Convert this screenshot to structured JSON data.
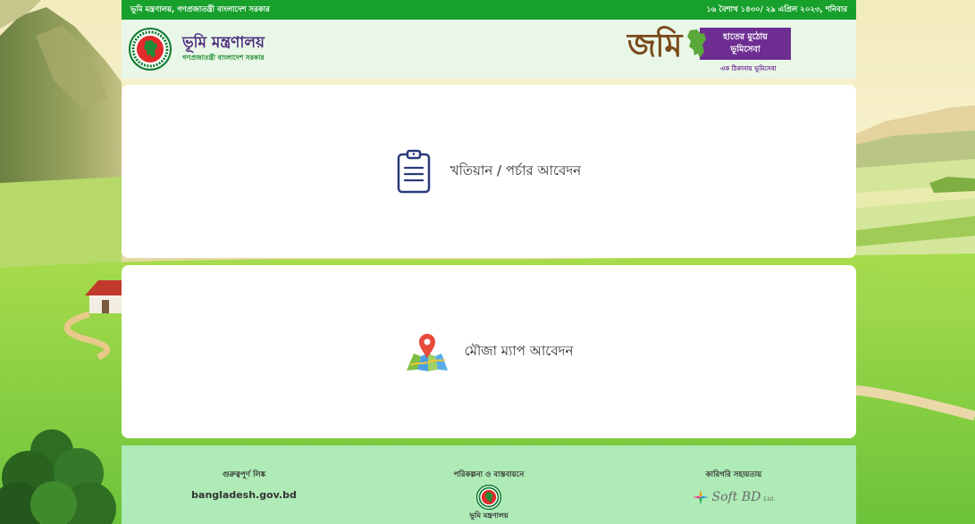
{
  "top_bar": {
    "left_text": "ভূমি মন্ত্রণালয়, গণপ্রজাতন্ত্রী বাংলাদেশ সরকার",
    "right_text": "১৬ বৈশাখ ১৪৩০/ ২৯ এপ্রিল ২০২৩, শনিবার"
  },
  "header": {
    "ministry_name": "ভূমি মন্ত্রণালয়",
    "ministry_subtitle": "গণপ্রজাতন্ত্রী বাংলাদেশ সরকার",
    "brand": {
      "wordmark": "জমি",
      "tagline_line1": "হাতের মুঠোয়",
      "tagline_line2": "ভূমিসেবা",
      "sub_tagline": "এক ঠিকানায় ভূমিসেবা"
    }
  },
  "services": [
    {
      "label": "খতিয়ান / পর্চার আবেদন",
      "icon": "clipboard-icon"
    },
    {
      "label": "মৌজা ম্যাপ আবেদন",
      "icon": "map-pin-icon"
    }
  ],
  "footer": {
    "important_links": {
      "heading": "গুরুত্বপূর্ণ লিঙ্ক",
      "link": "bangladesh.gov.bd"
    },
    "implementation": {
      "heading": "পরিকল্পনা ও বাস্তবায়নে",
      "org": "ভূমি মন্ত্রণালয়"
    },
    "technical_support": {
      "heading": "কারিগরি সহায়তায়",
      "brand": "Soft BD",
      "brand_suffix": "Ltd."
    }
  },
  "colors": {
    "top_bar": "#17a02c",
    "header_bg": "#e9f7e8",
    "ministry_name": "#4a2a7a",
    "brand_purple": "#6d2d91",
    "brand_brown": "#7a4a1c",
    "card_bg": "#ffffff",
    "footer_bg": "#aeebb6",
    "icon_navy": "#2b3a7a"
  }
}
